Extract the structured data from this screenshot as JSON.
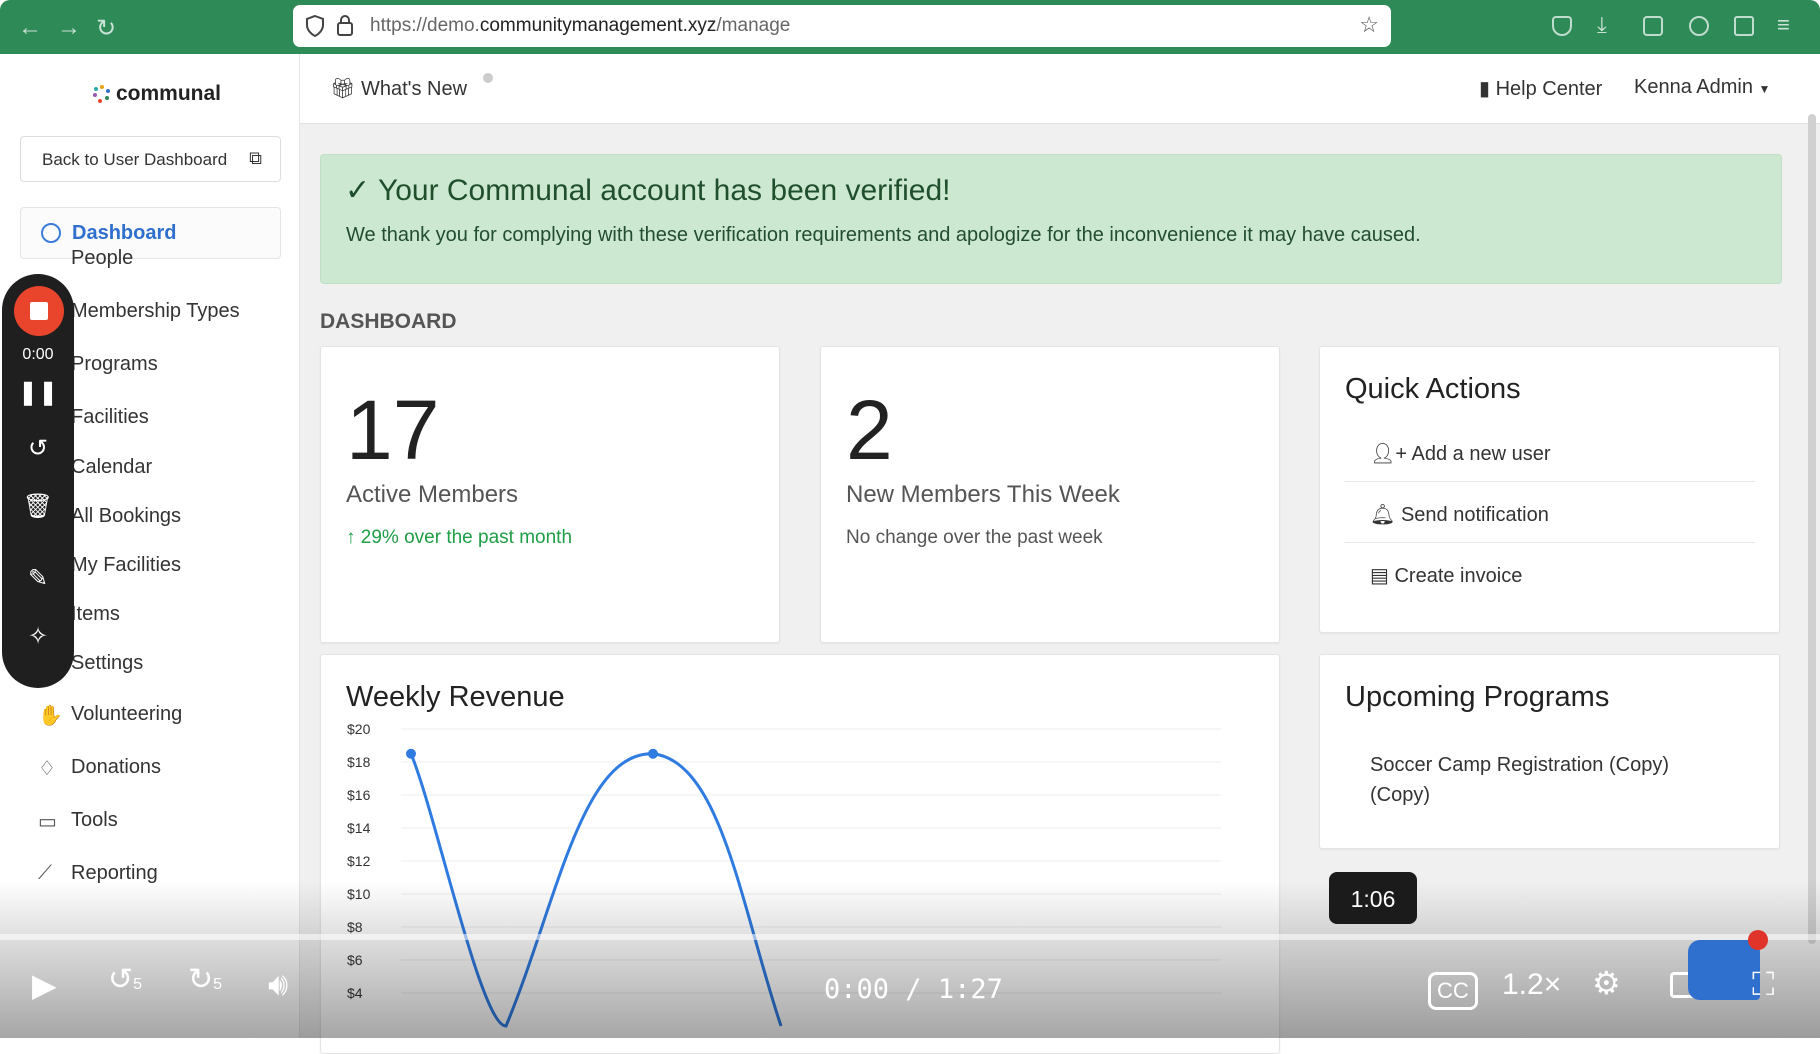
{
  "browser": {
    "url_prefix": "https://demo.",
    "url_domain": "communitymanagement.xyz",
    "url_path": "/manage"
  },
  "sidebar": {
    "logo": "communal",
    "back_button": "Back to User Dashboard",
    "dashboard": "Dashboard",
    "items": [
      "People",
      "Membership Types",
      "Programs",
      "Facilities",
      "Calendar",
      "All Bookings",
      "My Facilities",
      "Items",
      "Settings",
      "Volunteering",
      "Donations",
      "Tools",
      "Reporting"
    ]
  },
  "topbar": {
    "whats_new": "What's New",
    "help_center": "Help Center",
    "user": "Kenna Admin"
  },
  "alert": {
    "title": "Your Communal account has been verified!",
    "body": "We thank you for complying with these verification requirements and apologize for the inconvenience it may have caused."
  },
  "dashboard_label": "DASHBOARD",
  "stats": {
    "active_members_value": "17",
    "active_members_label": "Active Members",
    "active_members_change": "29% over the past month",
    "new_members_value": "2",
    "new_members_label": "New Members This Week",
    "new_members_change": "No change over the past week"
  },
  "quick_actions": {
    "title": "Quick Actions",
    "items": [
      "Add a new user",
      "Send notification",
      "Create invoice"
    ]
  },
  "upcoming_programs": {
    "title": "Upcoming Programs",
    "items": [
      "Soccer Camp Registration (Copy) (Copy)"
    ]
  },
  "weekly_revenue": {
    "title": "Weekly Revenue"
  },
  "chart_data": {
    "type": "line",
    "title": "Weekly Revenue",
    "y_ticks": [
      "$20",
      "$18",
      "$16",
      "$14",
      "$12",
      "$10",
      "$8",
      "$6",
      "$4"
    ],
    "ylim": [
      2,
      20
    ],
    "series": [
      {
        "values": [
          18.5,
          2,
          18.5,
          2
        ]
      }
    ],
    "color": "#2f7be0"
  },
  "recorder": {
    "time": "0:00"
  },
  "player": {
    "current": "0:00",
    "separator": "/",
    "duration": "1:27",
    "hover_time": "1:06",
    "speed": "1.2×",
    "skip_back": "5",
    "skip_fwd": "5",
    "cc": "CC"
  },
  "colors": {
    "browser_bar": "#2e8b57",
    "accent": "#2f6fce",
    "success": "#1e9e45",
    "alert_bg": "#cce8d1"
  }
}
